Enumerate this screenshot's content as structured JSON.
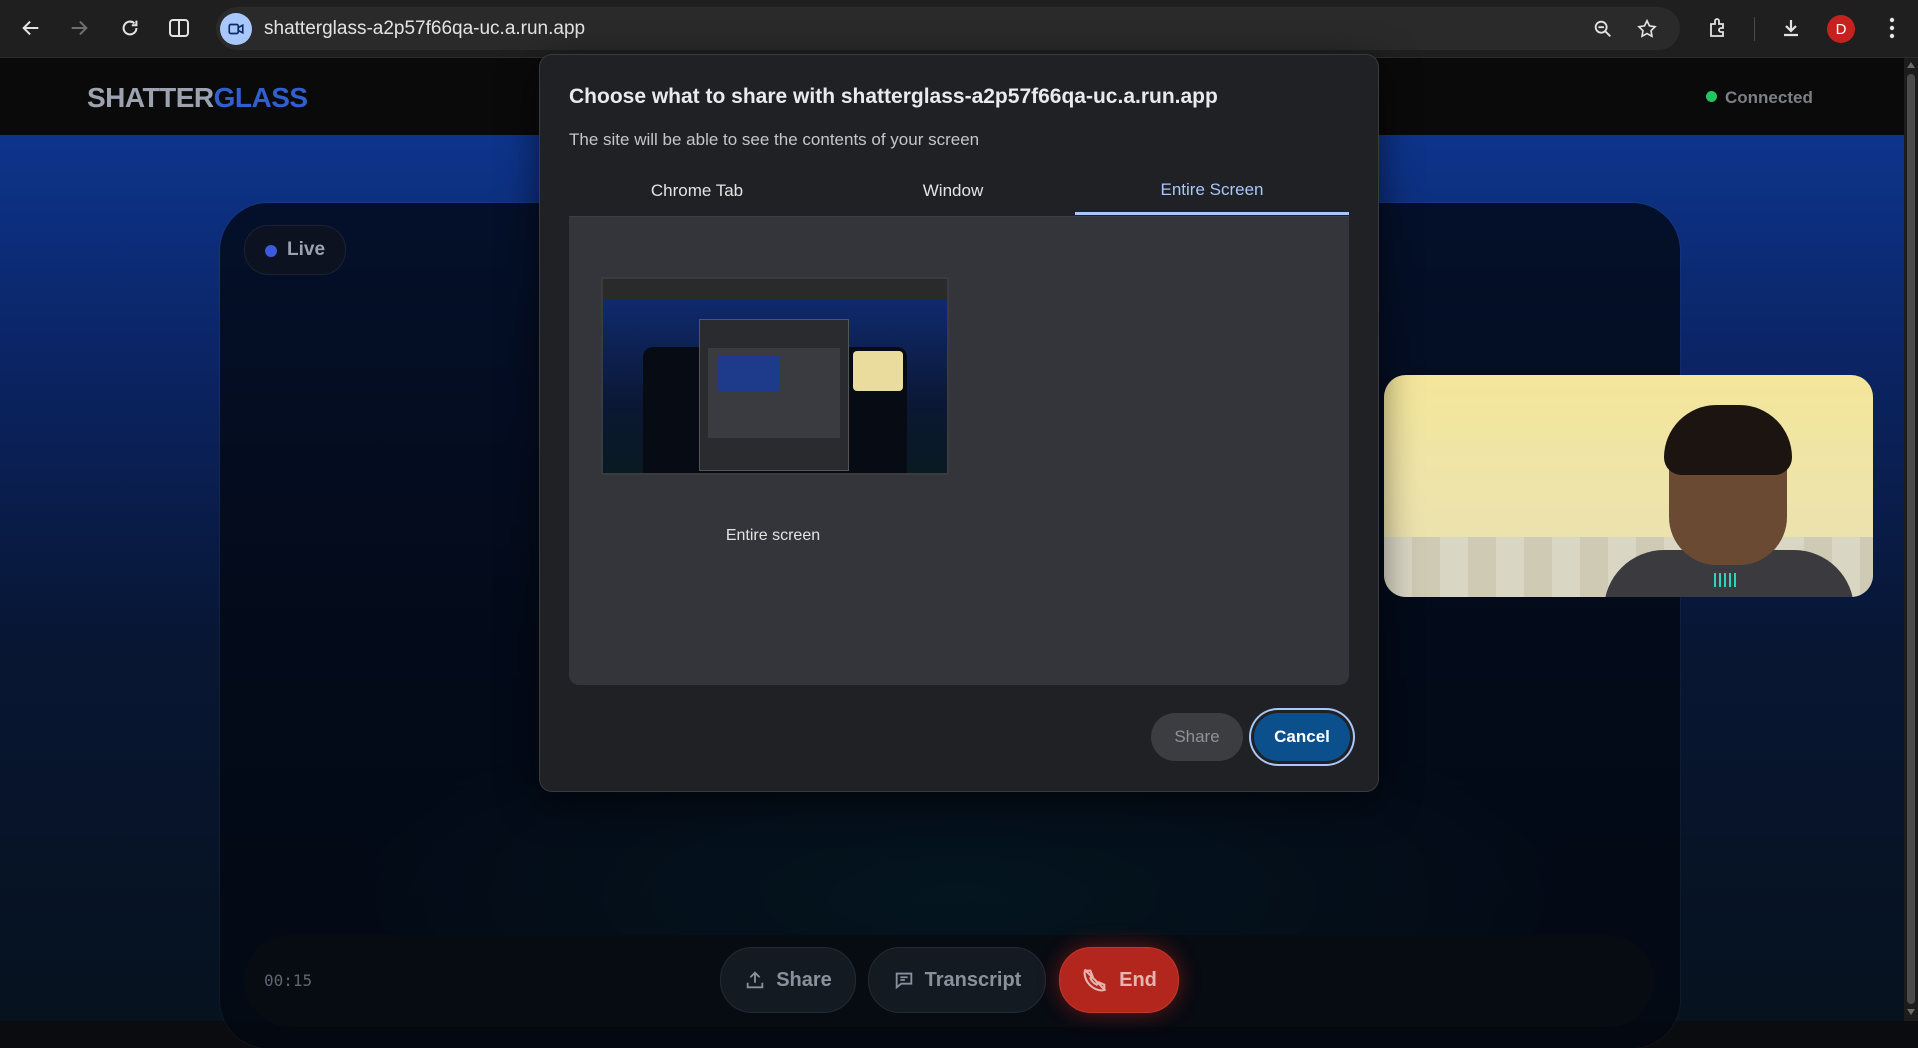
{
  "browser": {
    "url": "shatterglass-a2p57f66qa-uc.a.run.app",
    "profile_initial": "D",
    "icons": [
      "back-icon",
      "forward-icon",
      "reload-icon",
      "split-view-icon",
      "site-camera-icon",
      "zoom-icon",
      "star-icon",
      "extensions-icon",
      "download-icon",
      "kebab-menu-icon"
    ]
  },
  "app": {
    "logo_part1": "SHATTER",
    "logo_part2": "GLASS",
    "status": "Connected",
    "live_label": "Live",
    "timer": "00:15",
    "controls": {
      "share": "Share",
      "transcript": "Transcript",
      "end": "End"
    }
  },
  "dialog": {
    "title": "Choose what to share with shatterglass-a2p57f66qa-uc.a.run.app",
    "subtitle": "The site will be able to see the contents of your screen",
    "tabs": [
      "Chrome Tab",
      "Window",
      "Entire Screen"
    ],
    "active_tab": "Entire Screen",
    "source_label": "Entire screen",
    "share_button": "Share",
    "cancel_button": "Cancel"
  },
  "colors": {
    "accent": "#a8c7fa",
    "cancel_bg": "#0b4f8c",
    "end_bg": "#b3261e",
    "connected": "#22c55e",
    "logo_blue": "#2f5fd0"
  }
}
